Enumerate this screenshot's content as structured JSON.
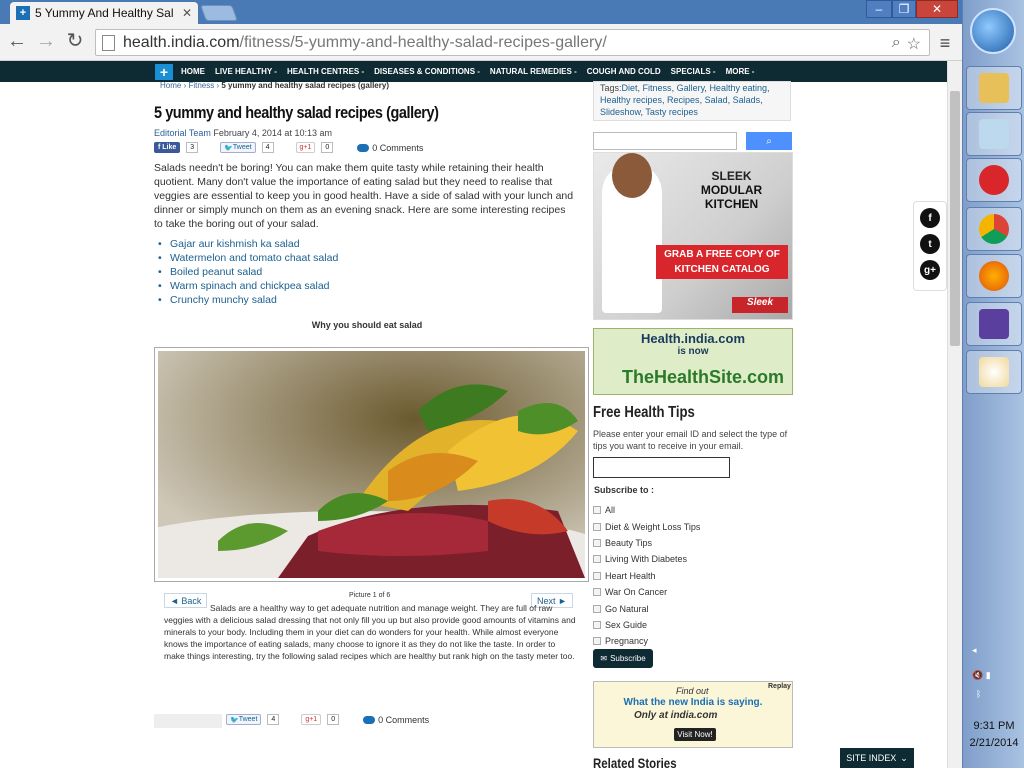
{
  "browser": {
    "tab_title": "5 Yummy And Healthy Sal",
    "url_domain": "health.india.com",
    "url_path": "/fitness/5-yummy-and-healthy-salad-recipes-gallery/"
  },
  "nav": {
    "items": [
      "HOME",
      "LIVE HEALTHY -",
      "HEALTH CENTRES -",
      "DISEASES & CONDITIONS -",
      "NATURAL REMEDIES -",
      "COUGH AND COLD",
      "SPECIALS -",
      "MORE -"
    ]
  },
  "breadcrumb": {
    "home": "Home",
    "sep": " › ",
    "section": "Fitness",
    "current": "5 yummy and healthy salad recipes (gallery)"
  },
  "article": {
    "title": "5 yummy and healthy salad recipes (gallery)",
    "author": "Editorial Team",
    "date": "February 4, 2014 at 10:13 am",
    "share": {
      "like": "Like",
      "like_count": "3",
      "tweet": "Tweet",
      "tweet_count": "4",
      "gplus": "g+1",
      "gplus_count": "0",
      "comments": "0 Comments"
    },
    "intro": "Salads needn't be boring! You can make them quite tasty while retaining their health quotient. Many don't value the importance of eating salad but they need to realise that veggies are essential to keep you in good health. Have a side of salad with your lunch and dinner or simply munch on them as an evening snack. Here are some interesting recipes to take the boring out of your salad.",
    "recipes": [
      "Gajar aur kishmish ka salad",
      "Watermelon and tomato chaat salad",
      "Boiled peanut salad",
      "Warm spinach and chickpea salad",
      "Crunchy munchy salad"
    ],
    "section_heading": "Why you should eat salad",
    "gallery": {
      "back": "◄ Back",
      "next": "Next ►",
      "picture": "Picture 1 of 6"
    },
    "gallery_text": "Salads are a healthy way to get adequate nutrition and manage weight. They are full of raw veggies with a delicious salad dressing that not only fill you up but also provide good amounts of vitamins and minerals to your body. Including them in your diet can do wonders for your health. While almost everyone knows the importance of eating salads, many choose to ignore it as they do not like the taste. In order to make things interesting, try the following salad recipes which are healthy but rank high on the tasty meter too.",
    "bottom_share": {
      "tweet": "Tweet",
      "tweet_count": "4",
      "gplus": "g+1",
      "gplus_count": "0",
      "comments": "0 Comments"
    }
  },
  "sidebar": {
    "tags_label": "Tags:",
    "tags": [
      "Diet",
      "Fitness",
      "Gallery",
      "Healthy eating",
      "Healthy recipes",
      "Recipes",
      "Salad",
      "Salads",
      "Slideshow",
      "Tasty recipes"
    ],
    "ad1": {
      "line1": "SLEEK",
      "line2": "MODULAR KITCHEN",
      "cta1": "GRAB A FREE COPY OF",
      "cta2": "KITCHEN CATALOG",
      "brand": "Sleek"
    },
    "ad2": {
      "line1": "Health.india.com",
      "line2": "is now",
      "brand": "TheHealthSite.com"
    },
    "tips_title": "Free Health Tips",
    "tips_desc": "Please enter your email ID and select the type of tips you want to receive in your email.",
    "subscribe_to": "Subscribe to :",
    "options": [
      "All",
      "Diet & Weight Loss Tips",
      "Beauty Tips",
      "Living With Diabetes",
      "Heart Health",
      "War On Cancer",
      "Go Natural",
      "Sex Guide",
      "Pregnancy"
    ],
    "subscribe_btn": "Subscribe",
    "ad3": {
      "l1": "Find out",
      "l2": "What the new India is saying.",
      "l3": "Only at india.com",
      "btn": "Visit Now!",
      "replay": "Replay"
    },
    "related": "Related Stories"
  },
  "site_index": "SITE INDEX",
  "taskbar": {
    "time": "9:31 PM",
    "date": "2/21/2014"
  },
  "colors": {
    "nav_bg": "#0e2a33",
    "link": "#1b5f8f",
    "accent": "#4d90fe"
  }
}
